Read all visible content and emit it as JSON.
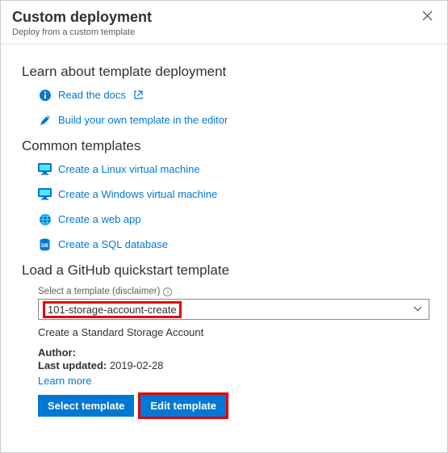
{
  "header": {
    "title": "Custom deployment",
    "subtitle": "Deploy from a custom template"
  },
  "sections": {
    "learn": {
      "heading": "Learn about template deployment",
      "links": {
        "docs": "Read the docs",
        "build": "Build your own template in the editor"
      }
    },
    "common": {
      "heading": "Common templates",
      "links": {
        "linux": "Create a Linux virtual machine",
        "windows": "Create a Windows virtual machine",
        "webapp": "Create a web app",
        "sql": "Create a SQL database"
      }
    },
    "github": {
      "heading": "Load a GitHub quickstart template",
      "select_label": "Select a template (disclaimer)",
      "selected_value": "101-storage-account-create",
      "description": "Create a Standard Storage Account",
      "author_label": "Author:",
      "updated_label": "Last updated:",
      "updated_value": "2019-02-28",
      "learn_more": "Learn more",
      "buttons": {
        "select": "Select template",
        "edit": "Edit template"
      }
    }
  }
}
